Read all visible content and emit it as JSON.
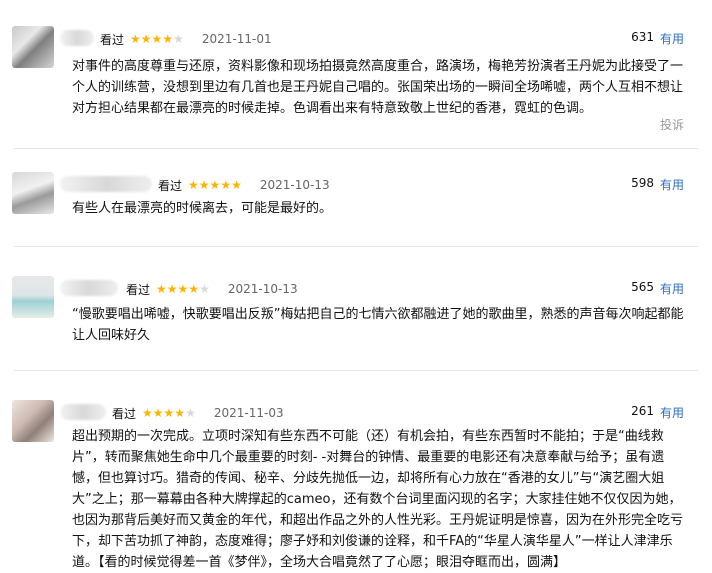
{
  "useful_label": "有用",
  "report_label": "投诉",
  "watched_label": "看过",
  "reviews": [
    {
      "date": "2021-11-01",
      "votes": "631",
      "rating": 4,
      "text": "对事件的高度尊重与还原，资料影像和现场拍摄竟然高度重合，路演场，梅艳芳扮演者王丹妮为此接受了一个人的训练营，没想到里边有几首也是王丹妮自己唱的。张国荣出场的一瞬间全场唏嘘，两个人互相不想让对方担心结果都在最漂亮的时候走掉。色调看出来有特意致敬上世纪的香港，霓虹的色调。"
    },
    {
      "date": "2021-10-13",
      "votes": "598",
      "rating": 5,
      "text": "有些人在最漂亮的时候离去，可能是最好的。"
    },
    {
      "date": "2021-10-13",
      "votes": "565",
      "rating": 4,
      "text": "“慢歌要唱出唏嘘，快歌要唱出反叛”梅姑把自己的七情六欲都融进了她的歌曲里，熟悉的声音每次响起都能让人回味好久"
    },
    {
      "date": "2021-11-03",
      "votes": "261",
      "rating": 4,
      "text": "超出预期的一次完成。立项时深知有些东西不可能（还）有机会拍，有些东西暂时不能拍；于是“曲线救片”，转而聚焦她生命中几个最重要的时刻- -对舞台的钟情、最重要的电影还有决意奉献与给予；虽有遗憾，但也算讨巧。猎奇的传闻、秘辛、分歧先抛低一边，却将所有心力放在“香港的女儿”与“演艺圈大姐大”之上；那一幕幕由各种大牌撑起的cameo，还有数个台词里面闪现的名字；大家挂住她不仅仅因为她，也因为那背后美好而又黄金的年代，和超出作品之外的人性光彩。王丹妮证明是惊喜，因为在外形完全吃亏下，却下苦功抓了神韵，态度难得；廖子妤和刘俊谦的诠释，和千FA的“华星人演华星人”一样让人津津乐道。【看的时候觉得差一首《梦伴》，全场大合唱竟然了了心愿；眼泪夺眶而出，圆满】"
    }
  ]
}
